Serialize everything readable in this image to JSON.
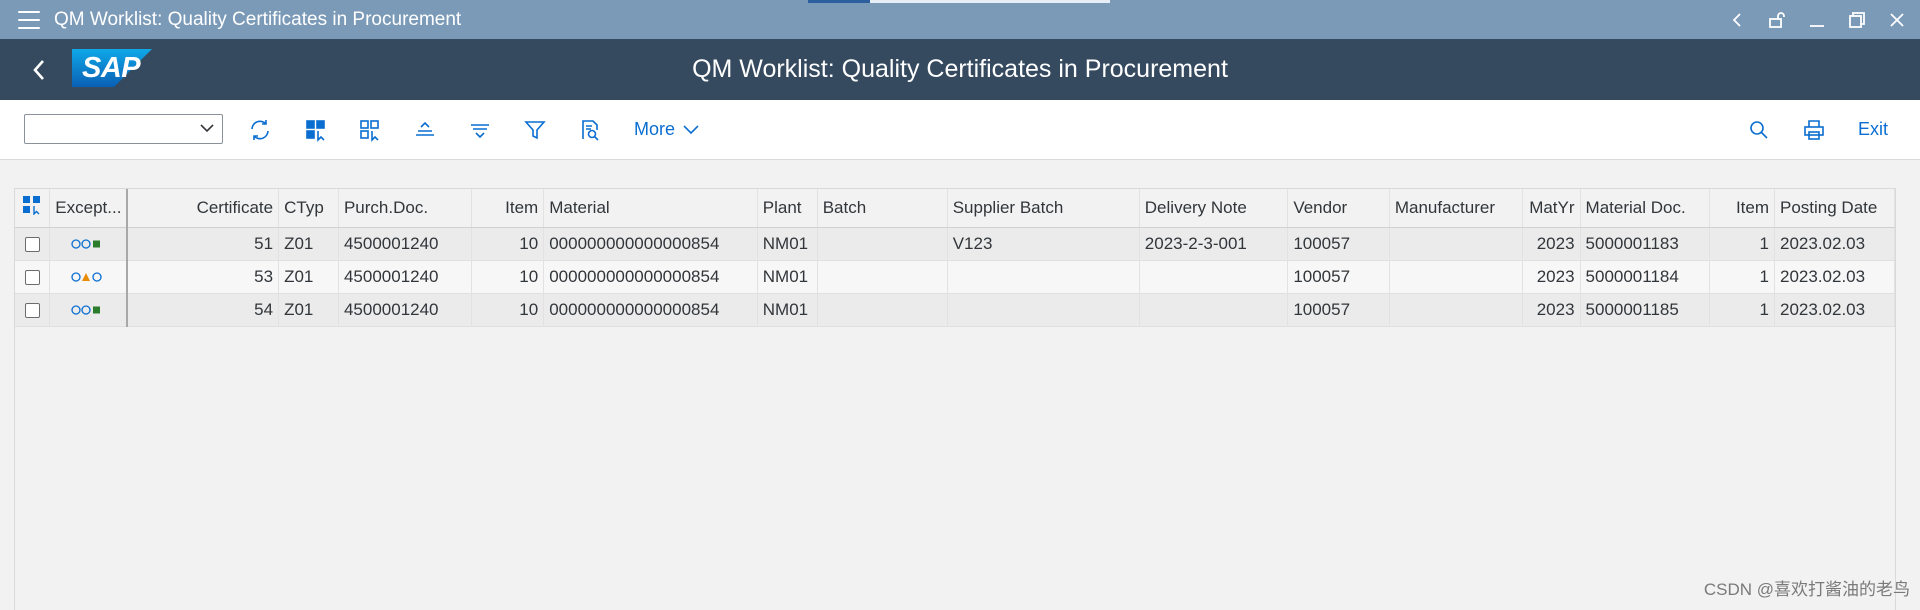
{
  "window": {
    "title": "QM Worklist: Quality Certificates in Procurement"
  },
  "shell": {
    "title": "QM Worklist: Quality Certificates in Procurement",
    "logo_text": "SAP"
  },
  "toolbar": {
    "variant_value": "",
    "more_label": "More",
    "exit_label": "Exit"
  },
  "table": {
    "columns": [
      "Except...",
      "Certificate",
      "CTyp",
      "Purch.Doc.",
      "Item",
      "Material",
      "Plant",
      "Batch",
      "Supplier Batch",
      "Delivery Note",
      "Vendor",
      "Manufacturer",
      "MatYr",
      "Material Doc.",
      "Item",
      "Posting Date"
    ],
    "rows": [
      {
        "exception": "green",
        "certificate": "51",
        "ctyp": "Z01",
        "purch_doc": "4500001240",
        "item": "10",
        "material": "000000000000000854",
        "plant": "NM01",
        "batch": "",
        "supplier_batch": "V123",
        "delivery_note": "2023-2-3-001",
        "vendor": "100057",
        "manufacturer": "",
        "matyr": "2023",
        "material_doc": "5000001183",
        "item2": "1",
        "posting_date": "2023.02.03"
      },
      {
        "exception": "yellow",
        "certificate": "53",
        "ctyp": "Z01",
        "purch_doc": "4500001240",
        "item": "10",
        "material": "000000000000000854",
        "plant": "NM01",
        "batch": "",
        "supplier_batch": "",
        "delivery_note": "",
        "vendor": "100057",
        "manufacturer": "",
        "matyr": "2023",
        "material_doc": "5000001184",
        "item2": "1",
        "posting_date": "2023.02.03"
      },
      {
        "exception": "green",
        "certificate": "54",
        "ctyp": "Z01",
        "purch_doc": "4500001240",
        "item": "10",
        "material": "000000000000000854",
        "plant": "NM01",
        "batch": "",
        "supplier_batch": "",
        "delivery_note": "",
        "vendor": "100057",
        "manufacturer": "",
        "matyr": "2023",
        "material_doc": "5000001185",
        "item2": "1",
        "posting_date": "2023.02.03"
      }
    ]
  },
  "icons": {
    "titlebar": [
      "hamburger-menu-icon",
      "chevron-left-icon",
      "unlock-icon",
      "minimize-icon",
      "restore-icon",
      "close-icon"
    ],
    "toolbar": [
      "refresh-icon",
      "select-layout-icon",
      "details-icon",
      "sort-ascending-icon",
      "sort-descending-icon",
      "filter-icon",
      "print-preview-icon",
      "search-icon",
      "print-icon"
    ]
  },
  "colors": {
    "shell": "#354a5f",
    "titlebar": "#7b9ab8",
    "accent": "#0a6ed1",
    "status_green": "#2b7d2b",
    "status_yellow": "#e78c07"
  },
  "watermark": "CSDN @喜欢打酱油的老鸟"
}
